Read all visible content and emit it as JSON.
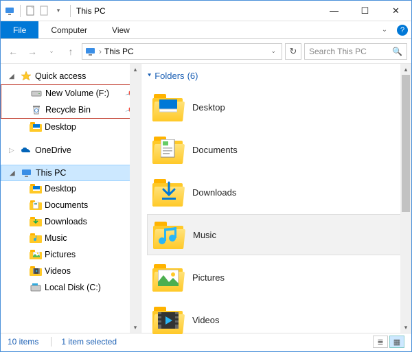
{
  "title": "This PC",
  "ribbon": {
    "file": "File",
    "tabs": [
      "Computer",
      "View"
    ]
  },
  "address": {
    "crumb": "This PC"
  },
  "search": {
    "placeholder": "Search This PC"
  },
  "nav": {
    "quick_access": {
      "label": "Quick access",
      "items": [
        {
          "label": "New Volume (F:)",
          "icon": "drive"
        },
        {
          "label": "Recycle Bin",
          "icon": "recycle"
        },
        {
          "label": "Desktop",
          "icon": "folder-desktop"
        }
      ]
    },
    "onedrive": {
      "label": "OneDrive"
    },
    "this_pc": {
      "label": "This PC",
      "items": [
        {
          "label": "Desktop"
        },
        {
          "label": "Documents"
        },
        {
          "label": "Downloads"
        },
        {
          "label": "Music"
        },
        {
          "label": "Pictures"
        },
        {
          "label": "Videos"
        },
        {
          "label": "Local Disk (C:)"
        }
      ]
    }
  },
  "content": {
    "section": {
      "label": "Folders",
      "count": 6
    },
    "folders": [
      {
        "label": "Desktop",
        "icon": "desktop"
      },
      {
        "label": "Documents",
        "icon": "documents"
      },
      {
        "label": "Downloads",
        "icon": "downloads"
      },
      {
        "label": "Music",
        "icon": "music",
        "hover": true
      },
      {
        "label": "Pictures",
        "icon": "pictures"
      },
      {
        "label": "Videos",
        "icon": "videos"
      }
    ]
  },
  "status": {
    "items": "10 items",
    "selected": "1 item selected"
  }
}
